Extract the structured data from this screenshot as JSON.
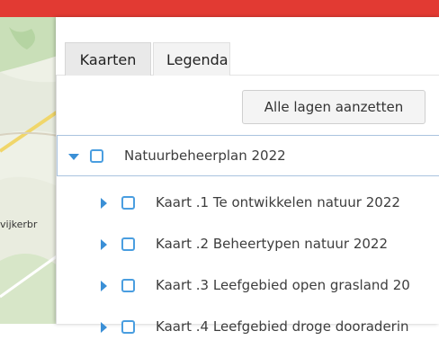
{
  "map": {
    "place_label": "vijkerbr"
  },
  "tabs": [
    {
      "label": "Kaarten",
      "active": true
    },
    {
      "label": "Legenda",
      "active": false
    }
  ],
  "toolbar": {
    "all_layers_label": "Alle lagen aanzetten"
  },
  "layers": {
    "root": {
      "label": "Natuurbeheerplan 2022",
      "expanded": true
    },
    "items": [
      {
        "label": "Kaart .1 Te ontwikkelen natuur 2022"
      },
      {
        "label": "Kaart .2 Beheertypen natuur 2022"
      },
      {
        "label": "Kaart .3 Leefgebied open grasland 20"
      },
      {
        "label": "Kaart .4 Leefgebied droge dooraderin"
      }
    ]
  },
  "colors": {
    "topbar": "#e23a33",
    "accent": "#3a8fd6"
  }
}
